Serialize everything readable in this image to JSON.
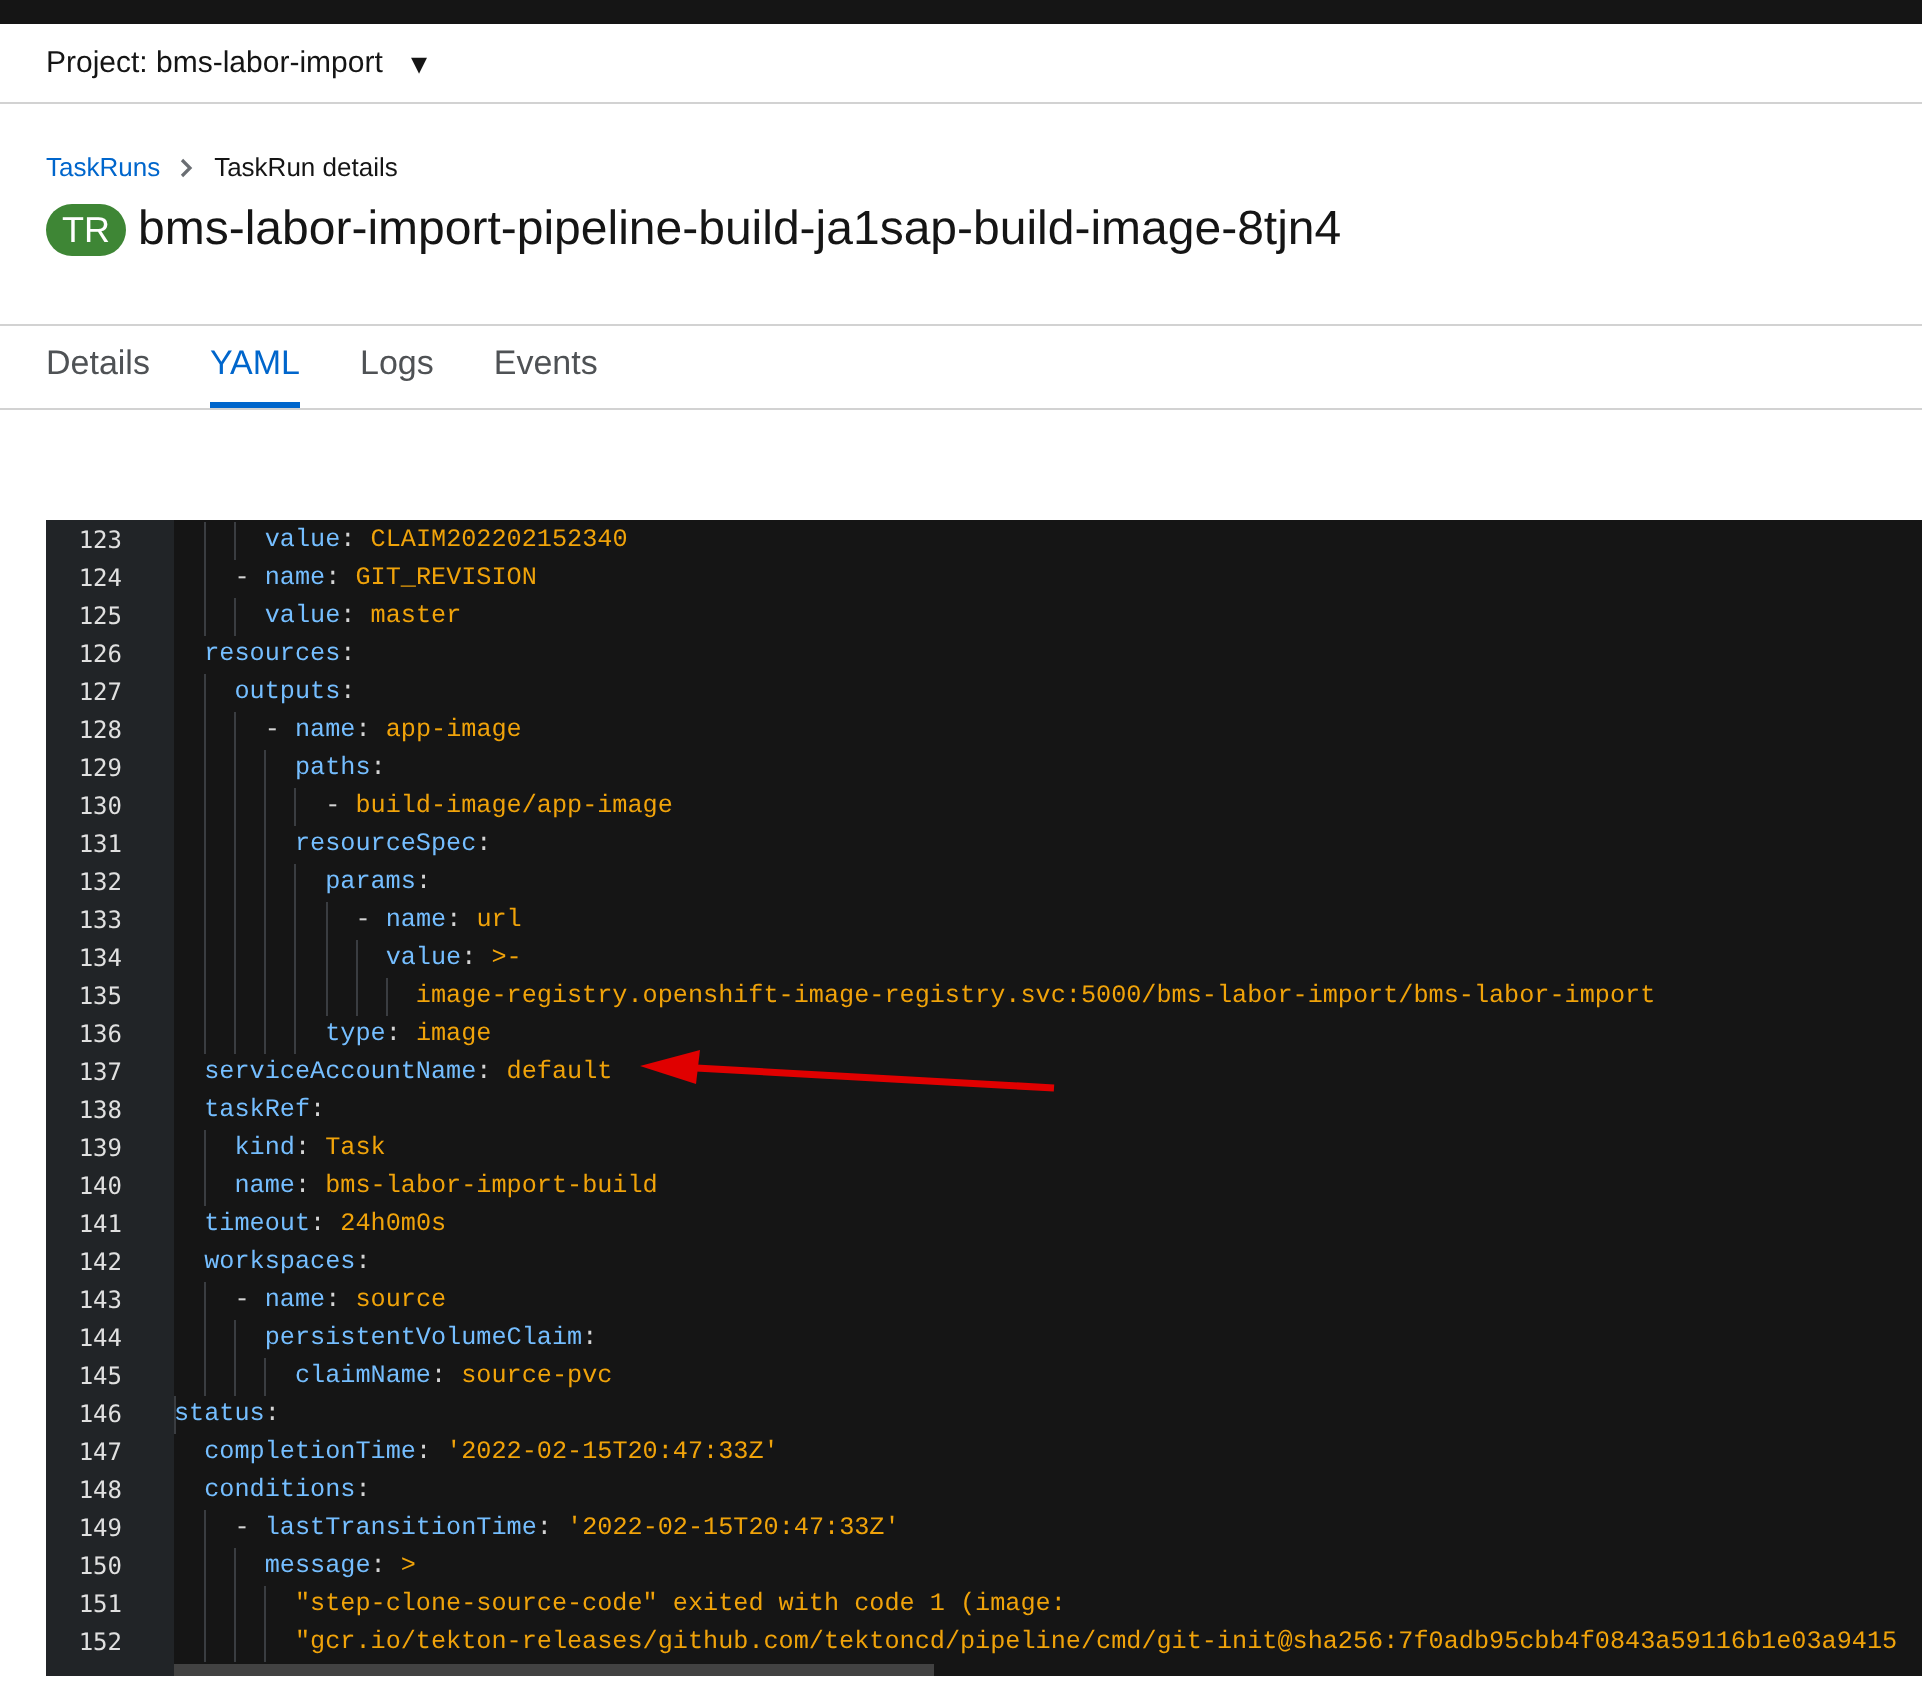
{
  "masthead": {
    "project_label": "Project: bms-labor-import",
    "dropdown_caret": "▾"
  },
  "breadcrumb": [
    {
      "label": "TaskRuns",
      "link": true
    },
    {
      "label": "TaskRun details",
      "link": false
    }
  ],
  "title": {
    "badge": "TR",
    "name": "bms-labor-import-pipeline-build-ja1sap-build-image-8tjn4"
  },
  "tabs": [
    {
      "label": "Details",
      "selected": false
    },
    {
      "label": "YAML",
      "selected": true
    },
    {
      "label": "Logs",
      "selected": false
    },
    {
      "label": "Events",
      "selected": false
    }
  ],
  "editor": {
    "lines": [
      {
        "number": "123",
        "code": "      value: CLAIM202202152340"
      },
      {
        "number": "124",
        "code": "    - name: GIT_REVISION"
      },
      {
        "number": "125",
        "code": "      value: master"
      },
      {
        "number": "126",
        "code": "  resources:"
      },
      {
        "number": "127",
        "code": "    outputs:"
      },
      {
        "number": "128",
        "code": "      - name: app-image"
      },
      {
        "number": "129",
        "code": "        paths:"
      },
      {
        "number": "130",
        "code": "          - build-image/app-image"
      },
      {
        "number": "131",
        "code": "        resourceSpec:"
      },
      {
        "number": "132",
        "code": "          params:"
      },
      {
        "number": "133",
        "code": "            - name: url"
      },
      {
        "number": "134",
        "code": "              value: >-"
      },
      {
        "number": "135",
        "code": "                image-registry.openshift-image-registry.svc:5000/bms-labor-import/bms-labor-import"
      },
      {
        "number": "136",
        "code": "          type: image"
      },
      {
        "number": "137",
        "code": "  serviceAccountName: default"
      },
      {
        "number": "138",
        "code": "  taskRef:"
      },
      {
        "number": "139",
        "code": "    kind: Task"
      },
      {
        "number": "140",
        "code": "    name: bms-labor-import-build"
      },
      {
        "number": "141",
        "code": "  timeout: 24h0m0s"
      },
      {
        "number": "142",
        "code": "  workspaces:"
      },
      {
        "number": "143",
        "code": "    - name: source"
      },
      {
        "number": "144",
        "code": "      persistentVolumeClaim:"
      },
      {
        "number": "145",
        "code": "        claimName: source-pvc"
      },
      {
        "number": "146",
        "code": "status:"
      },
      {
        "number": "147",
        "code": "  completionTime: '2022-02-15T20:47:33Z'"
      },
      {
        "number": "148",
        "code": "  conditions:"
      },
      {
        "number": "149",
        "code": "    - lastTransitionTime: '2022-02-15T20:47:33Z'"
      },
      {
        "number": "150",
        "code": "      message: >"
      },
      {
        "number": "151",
        "code": "        \"step-clone-source-code\" exited with code 1 (image:"
      },
      {
        "number": "152",
        "code": "        \"gcr.io/tekton-releases/github.com/tektoncd/pipeline/cmd/git-init@sha256:7f0adb95cbb4f0843a59116b1e03a9415"
      }
    ]
  }
}
